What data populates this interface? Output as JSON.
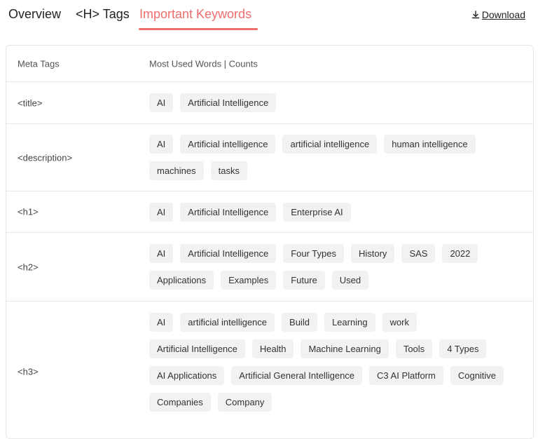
{
  "tabs": {
    "overview": "Overview",
    "htags": "<H> Tags",
    "keywords": "Important Keywords"
  },
  "download": {
    "label": "Download",
    "icon": "download-icon"
  },
  "colors": {
    "accent": "#ee6d6d",
    "chip_bg": "#f2f2f2",
    "border": "#e7e7e7"
  },
  "table": {
    "headers": {
      "meta": "Meta Tags",
      "words": "Most Used Words | Counts"
    },
    "rows": [
      {
        "tag": "<title>",
        "keywords": [
          "AI",
          "Artificial Intelligence"
        ]
      },
      {
        "tag": "<description>",
        "keywords": [
          "AI",
          "Artificial intelligence",
          "artificial intelligence",
          "human intelligence",
          "machines",
          "tasks"
        ]
      },
      {
        "tag": "<h1>",
        "keywords": [
          "AI",
          "Artificial Intelligence",
          "Enterprise AI"
        ]
      },
      {
        "tag": "<h2>",
        "keywords": [
          "AI",
          "Artificial Intelligence",
          "Four Types",
          "History",
          "SAS",
          "2022",
          "Applications",
          "Examples",
          "Future",
          "Used"
        ]
      },
      {
        "tag": "<h3>",
        "keywords": [
          "AI",
          "artificial intelligence",
          "Build",
          "Learning",
          "work",
          "Artificial Intelligence",
          "Health",
          "Machine Learning",
          "Tools",
          "4 Types",
          "AI Applications",
          "Artificial General Intelligence",
          "C3 AI Platform",
          "Cognitive",
          "Companies",
          "Company"
        ]
      }
    ]
  }
}
